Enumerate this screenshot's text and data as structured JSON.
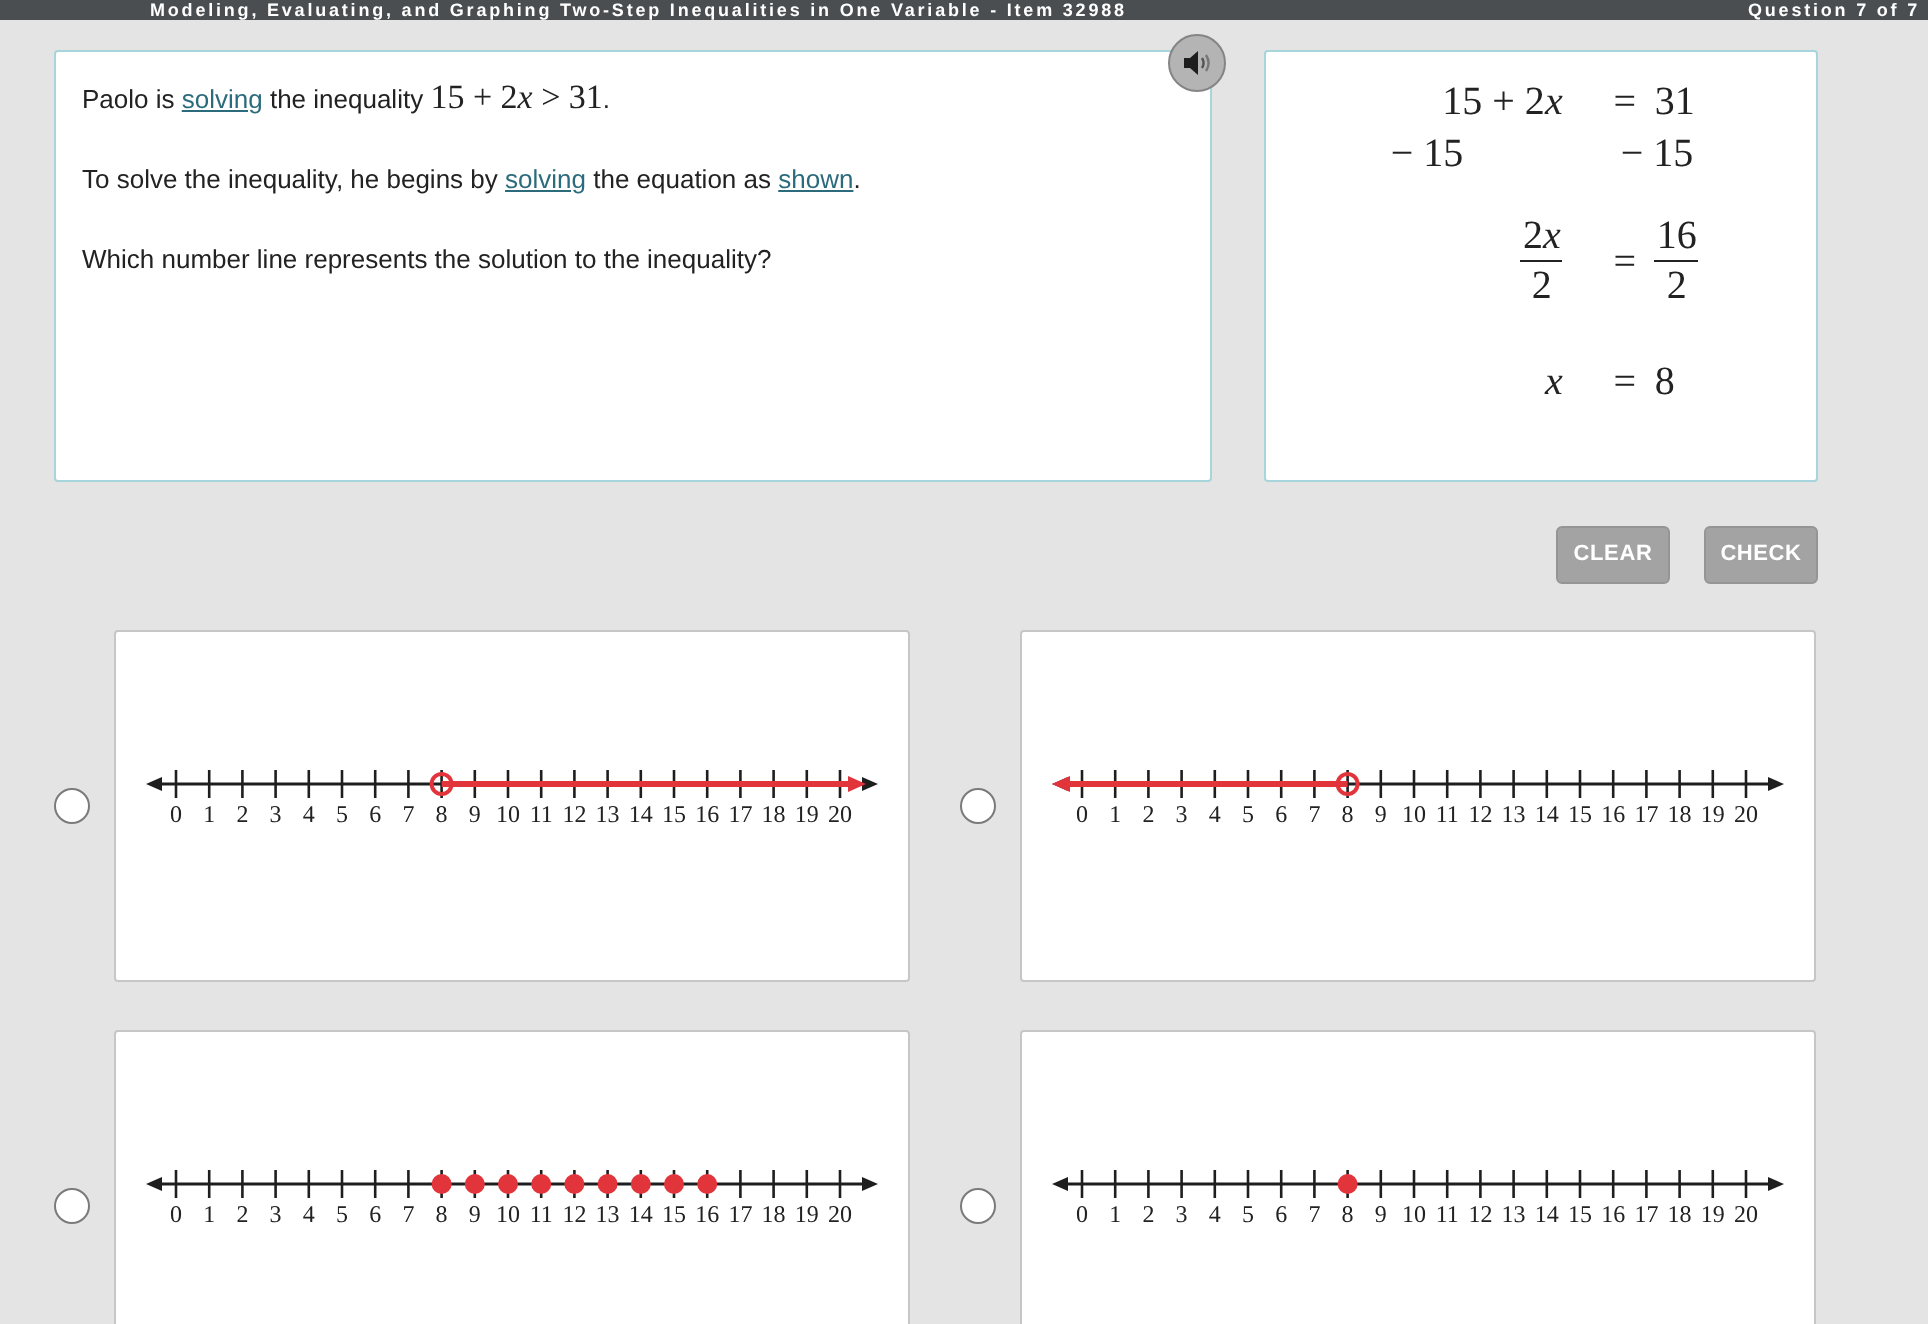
{
  "header": {
    "title": "Modeling, Evaluating, and Graphing Two-Step Inequalities in One Variable - Item 32988",
    "progress": "Question 7 of 7"
  },
  "question": {
    "paragraphs": [
      [
        {
          "kind": "text",
          "text": "Paolo is "
        },
        {
          "kind": "link",
          "text": "solving"
        },
        {
          "kind": "text",
          "text": " the inequality "
        },
        {
          "kind": "math",
          "text": "15 + 2"
        },
        {
          "kind": "variable",
          "text": "x"
        },
        {
          "kind": "math",
          "text": " > 31"
        },
        {
          "kind": "text",
          "text": "."
        }
      ],
      [
        {
          "kind": "text",
          "text": "To solve the inequality, he begins by "
        },
        {
          "kind": "link",
          "text": "solving"
        },
        {
          "kind": "text",
          "text": " the equation as "
        },
        {
          "kind": "link",
          "text": "shown"
        },
        {
          "kind": "text",
          "text": "."
        }
      ],
      [
        {
          "kind": "text",
          "text": "Which number line represents the solution to the inequality?"
        }
      ]
    ]
  },
  "work": [
    {
      "kind": "equation",
      "left": [
        {
          "kind": "number",
          "text": "15 + 2"
        },
        {
          "kind": "variable",
          "text": "x"
        }
      ],
      "sign": "=",
      "right": [
        {
          "kind": "number",
          "text": "31"
        }
      ]
    },
    {
      "kind": "step",
      "left": [
        {
          "kind": "number",
          "text": "− 15"
        }
      ],
      "right": [
        {
          "kind": "number",
          "text": "− 15"
        }
      ]
    },
    {
      "kind": "fraction",
      "left": {
        "numerator": [
          {
            "kind": "number",
            "text": "2"
          },
          {
            "kind": "variable",
            "text": "x"
          }
        ],
        "denominator": [
          {
            "kind": "number",
            "text": "2"
          }
        ]
      },
      "sign": "=",
      "right": {
        "numerator": [
          {
            "kind": "number",
            "text": "16"
          }
        ],
        "denominator": [
          {
            "kind": "number",
            "text": "2"
          }
        ]
      }
    },
    {
      "kind": "equation",
      "left": [
        {
          "kind": "variable",
          "text": "x"
        }
      ],
      "sign": "=",
      "right": [
        {
          "kind": "number",
          "text": "8"
        }
      ]
    }
  ],
  "buttons": [
    {
      "label": "CLEAR",
      "disabled": true
    },
    {
      "label": "CHECK",
      "disabled": true
    }
  ],
  "options": [
    {
      "selected": false,
      "shaded_left": false,
      "shaded_right": true,
      "ticks": [
        {
          "label": "0",
          "kind": "tick"
        },
        {
          "label": "1",
          "kind": "tick"
        },
        {
          "label": "2",
          "kind": "tick"
        },
        {
          "label": "3",
          "kind": "tick"
        },
        {
          "label": "4",
          "kind": "tick"
        },
        {
          "label": "5",
          "kind": "tick"
        },
        {
          "label": "6",
          "kind": "tick"
        },
        {
          "label": "7",
          "kind": "tick"
        },
        {
          "label": "8",
          "kind": "open_point"
        },
        {
          "label": "9",
          "kind": "tick"
        },
        {
          "label": "10",
          "kind": "tick"
        },
        {
          "label": "11",
          "kind": "tick"
        },
        {
          "label": "12",
          "kind": "tick"
        },
        {
          "label": "13",
          "kind": "tick"
        },
        {
          "label": "14",
          "kind": "tick"
        },
        {
          "label": "15",
          "kind": "tick"
        },
        {
          "label": "16",
          "kind": "tick"
        },
        {
          "label": "17",
          "kind": "tick"
        },
        {
          "label": "18",
          "kind": "tick"
        },
        {
          "label": "19",
          "kind": "tick"
        },
        {
          "label": "20",
          "kind": "tick"
        }
      ]
    },
    {
      "selected": false,
      "shaded_left": true,
      "shaded_right": false,
      "ticks": [
        {
          "label": "0",
          "kind": "tick"
        },
        {
          "label": "1",
          "kind": "tick"
        },
        {
          "label": "2",
          "kind": "tick"
        },
        {
          "label": "3",
          "kind": "tick"
        },
        {
          "label": "4",
          "kind": "tick"
        },
        {
          "label": "5",
          "kind": "tick"
        },
        {
          "label": "6",
          "kind": "tick"
        },
        {
          "label": "7",
          "kind": "tick"
        },
        {
          "label": "8",
          "kind": "open_point"
        },
        {
          "label": "9",
          "kind": "tick"
        },
        {
          "label": "10",
          "kind": "tick"
        },
        {
          "label": "11",
          "kind": "tick"
        },
        {
          "label": "12",
          "kind": "tick"
        },
        {
          "label": "13",
          "kind": "tick"
        },
        {
          "label": "14",
          "kind": "tick"
        },
        {
          "label": "15",
          "kind": "tick"
        },
        {
          "label": "16",
          "kind": "tick"
        },
        {
          "label": "17",
          "kind": "tick"
        },
        {
          "label": "18",
          "kind": "tick"
        },
        {
          "label": "19",
          "kind": "tick"
        },
        {
          "label": "20",
          "kind": "tick"
        }
      ]
    },
    {
      "selected": false,
      "shaded_left": false,
      "shaded_right": false,
      "ticks": [
        {
          "label": "0",
          "kind": "tick"
        },
        {
          "label": "1",
          "kind": "tick"
        },
        {
          "label": "2",
          "kind": "tick"
        },
        {
          "label": "3",
          "kind": "tick"
        },
        {
          "label": "4",
          "kind": "tick"
        },
        {
          "label": "5",
          "kind": "tick"
        },
        {
          "label": "6",
          "kind": "tick"
        },
        {
          "label": "7",
          "kind": "tick"
        },
        {
          "label": "8",
          "kind": "closed_point"
        },
        {
          "label": "9",
          "kind": "closed_point"
        },
        {
          "label": "10",
          "kind": "closed_point"
        },
        {
          "label": "11",
          "kind": "closed_point"
        },
        {
          "label": "12",
          "kind": "closed_point"
        },
        {
          "label": "13",
          "kind": "closed_point"
        },
        {
          "label": "14",
          "kind": "closed_point"
        },
        {
          "label": "15",
          "kind": "closed_point"
        },
        {
          "label": "16",
          "kind": "closed_point"
        },
        {
          "label": "17",
          "kind": "tick"
        },
        {
          "label": "18",
          "kind": "tick"
        },
        {
          "label": "19",
          "kind": "tick"
        },
        {
          "label": "20",
          "kind": "tick"
        }
      ]
    },
    {
      "selected": false,
      "shaded_left": false,
      "shaded_right": false,
      "ticks": [
        {
          "label": "0",
          "kind": "tick"
        },
        {
          "label": "1",
          "kind": "tick"
        },
        {
          "label": "2",
          "kind": "tick"
        },
        {
          "label": "3",
          "kind": "tick"
        },
        {
          "label": "4",
          "kind": "tick"
        },
        {
          "label": "5",
          "kind": "tick"
        },
        {
          "label": "6",
          "kind": "tick"
        },
        {
          "label": "7",
          "kind": "tick"
        },
        {
          "label": "8",
          "kind": "closed_point"
        },
        {
          "label": "9",
          "kind": "tick"
        },
        {
          "label": "10",
          "kind": "tick"
        },
        {
          "label": "11",
          "kind": "tick"
        },
        {
          "label": "12",
          "kind": "tick"
        },
        {
          "label": "13",
          "kind": "tick"
        },
        {
          "label": "14",
          "kind": "tick"
        },
        {
          "label": "15",
          "kind": "tick"
        },
        {
          "label": "16",
          "kind": "tick"
        },
        {
          "label": "17",
          "kind": "tick"
        },
        {
          "label": "18",
          "kind": "tick"
        },
        {
          "label": "19",
          "kind": "tick"
        },
        {
          "label": "20",
          "kind": "tick"
        }
      ]
    }
  ]
}
